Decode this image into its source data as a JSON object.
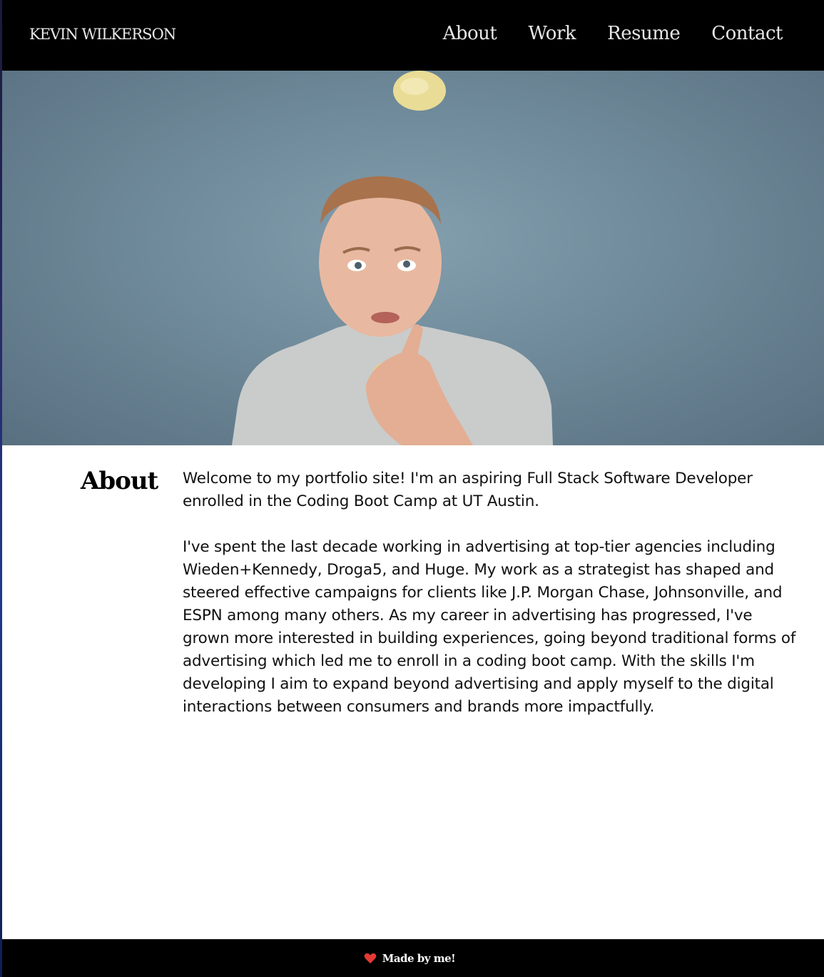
{
  "header": {
    "brand": "KEVIN WILKERSON",
    "nav": [
      {
        "label": "About"
      },
      {
        "label": "Work"
      },
      {
        "label": "Resume"
      },
      {
        "label": "Contact"
      }
    ]
  },
  "hero": {
    "background_color": "#7590a1"
  },
  "about": {
    "heading": "About",
    "paragraphs": [
      "Welcome to my portfolio site! I'm an aspiring Full Stack Software Developer enrolled in the Coding Boot Camp at UT Austin.",
      "I've spent the last decade working in advertising at top-tier agencies including Wieden+Kennedy, Droga5, and Huge. My work as a strategist has shaped and steered effective campaigns for clients like J.P. Morgan Chase, Johnsonville, and ESPN among many others. As my career in advertising has progressed, I've grown more interested in building experiences, going beyond traditional forms of advertising which led me to enroll in a coding boot camp. With the skills I'm developing I aim to expand beyond advertising and apply myself to the digital interactions between consumers and brands more impactfully."
    ]
  },
  "footer": {
    "icon": "heart-icon",
    "icon_color": "#e53935",
    "text": "Made by me!"
  }
}
